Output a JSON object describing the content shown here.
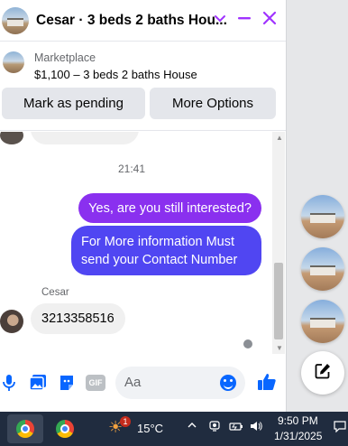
{
  "header": {
    "title": "Cesar · 3 beds 2 baths Hou...",
    "chevron_icon": "chevron-down-icon",
    "minimize_icon": "minimize-icon",
    "close_icon": "close-icon",
    "accent": "#a033ff"
  },
  "listing": {
    "source": "Marketplace",
    "price_title": "$1,100 – 3 beds 2 baths House",
    "pending_button": "Mark as pending",
    "options_button": "More Options"
  },
  "thread": {
    "timestamp": "21:41",
    "outgoing": [
      {
        "text": "Yes, are you still interested?",
        "color": "#8a30ef"
      },
      {
        "text": "For More information Must send your Contact Number",
        "color": "#5046f2"
      }
    ],
    "sender_name": "Cesar",
    "incoming": [
      {
        "text": "3213358516"
      }
    ]
  },
  "composer": {
    "placeholder": "Aa",
    "icons": [
      "microphone-icon",
      "photo-icon",
      "sticker-icon",
      "gif-icon",
      "emoji-icon",
      "like-icon"
    ],
    "gif_label": "GIF",
    "accent": "#0866ff"
  },
  "side": {
    "chat_heads": 3,
    "compose_icon": "new-message-icon"
  },
  "taskbar": {
    "weather_temp": "15°C",
    "time": "9:50 PM",
    "date": "1/31/2025",
    "weather_badge": "1",
    "background": "#202c3f"
  }
}
